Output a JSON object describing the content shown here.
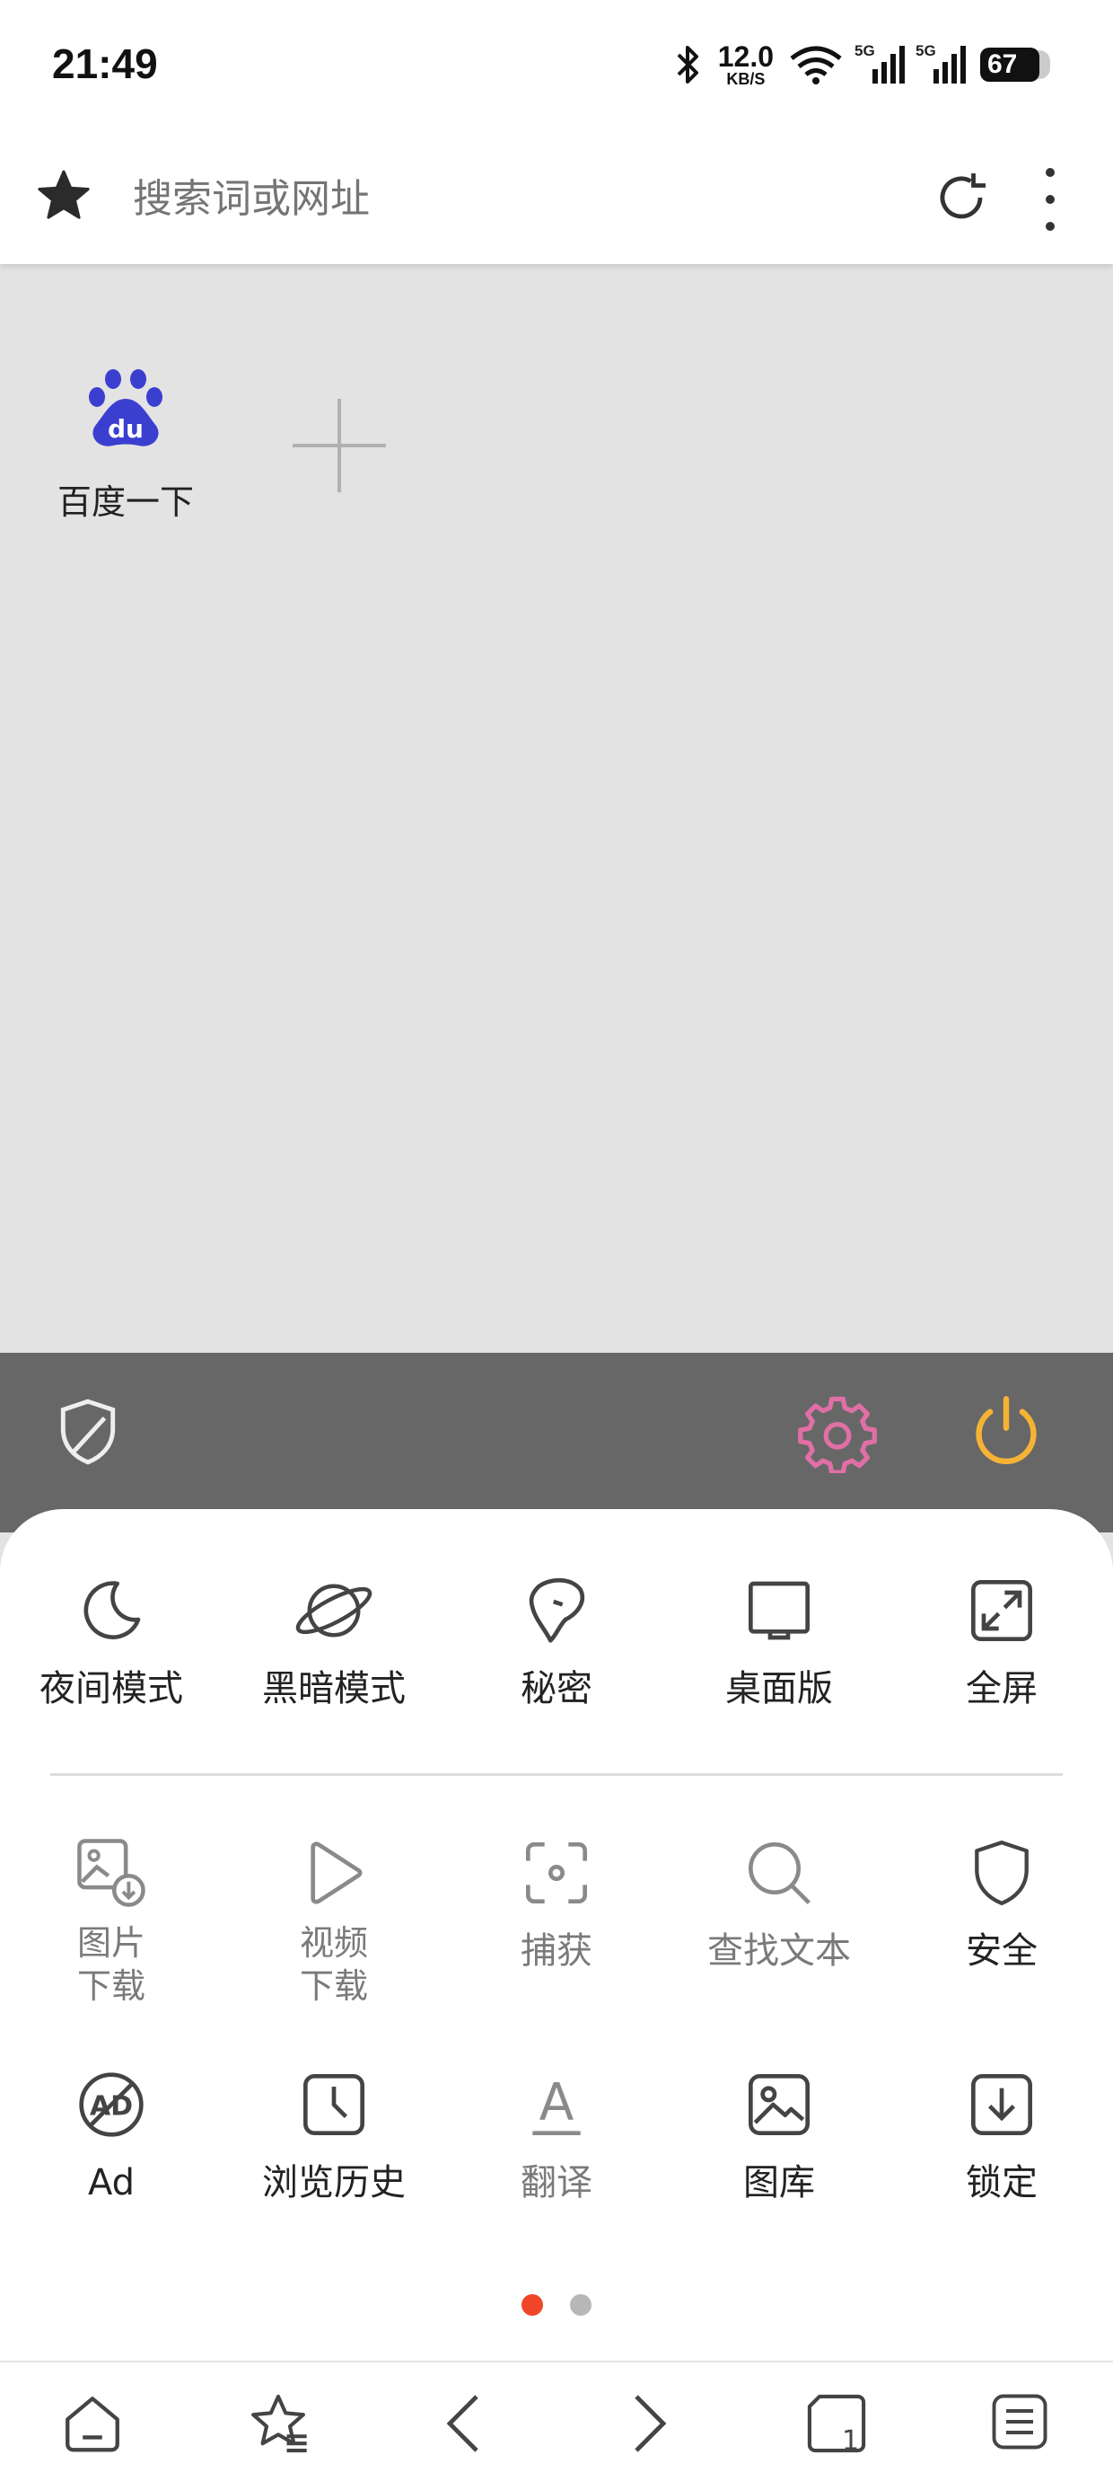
{
  "status_bar": {
    "time": "21:49",
    "net_speed_value": "12.0",
    "net_speed_unit": "KB/S",
    "sim1_label": "5G",
    "sim2_label": "5G",
    "battery": "67"
  },
  "address_bar": {
    "placeholder": "搜索词或网址"
  },
  "speed_dial": {
    "tiles": [
      {
        "label": "百度一下",
        "icon": "baidu-logo-icon"
      }
    ],
    "add_icon": "plus-icon"
  },
  "panel_header": {
    "left_icon": "shield-icon",
    "settings_icon": "gear-icon",
    "power_icon": "power-icon",
    "settings_color": "#e06fa5",
    "power_color": "#f5b335"
  },
  "menu": {
    "row1": [
      {
        "label": "夜间模式",
        "icon": "moon-icon"
      },
      {
        "label": "黑暗模式",
        "icon": "planet-icon"
      },
      {
        "label": "秘密",
        "icon": "mask-icon"
      },
      {
        "label": "桌面版",
        "icon": "monitor-icon"
      },
      {
        "label": "全屏",
        "icon": "fullscreen-icon"
      }
    ],
    "row2": [
      {
        "label_line1": "图片",
        "label_line2": "下载",
        "icon": "image-download-icon"
      },
      {
        "label_line1": "视频",
        "label_line2": "下载",
        "icon": "play-icon"
      },
      {
        "label": "捕获",
        "icon": "capture-icon"
      },
      {
        "label": "查找文本",
        "icon": "search-icon"
      },
      {
        "label": "安全",
        "icon": "shield-icon"
      }
    ],
    "row3": [
      {
        "label": "Ad",
        "icon": "ad-block-icon",
        "icon_text": "AD"
      },
      {
        "label": "浏览历史",
        "icon": "history-icon"
      },
      {
        "label": "翻译",
        "icon": "translate-icon",
        "icon_text": "A"
      },
      {
        "label": "图库",
        "icon": "gallery-icon"
      },
      {
        "label": "锁定",
        "icon": "lock-download-icon"
      }
    ],
    "page_indicator": {
      "total": 2,
      "active": 1,
      "active_color": "#ef4629"
    }
  },
  "bottom_nav": {
    "tab_count": "1",
    "items": [
      "home-icon",
      "bookmarks-icon",
      "back-icon",
      "forward-icon",
      "tabs-icon",
      "menu-icon"
    ]
  }
}
